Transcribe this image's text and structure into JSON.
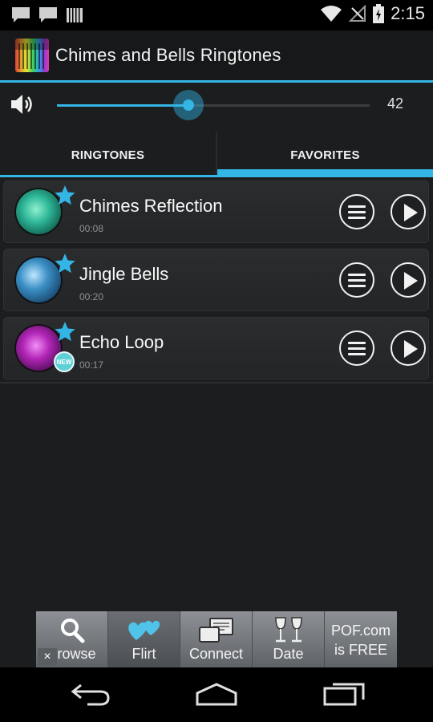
{
  "status_bar": {
    "time": "2:15",
    "icons": [
      "chat-notification-icon",
      "chat-notification-icon",
      "barcode-icon",
      "wifi-icon",
      "no-sim-icon",
      "battery-icon"
    ]
  },
  "action_bar": {
    "title": "Chimes and Bells Ringtones",
    "icon": "app-equalizer-icon"
  },
  "volume": {
    "value": "42",
    "level_fraction": 0.42,
    "icon": "speaker-icon"
  },
  "tabs": [
    {
      "label": "RINGTONES",
      "selected": false
    },
    {
      "label": "FAVORITES",
      "selected": true
    }
  ],
  "ringtones": [
    {
      "title": "Chimes Reflection",
      "duration": "00:08",
      "favorite": true,
      "new": false,
      "thumb_color": "#2fb89a"
    },
    {
      "title": "Jingle Bells",
      "duration": "00:20",
      "favorite": true,
      "new": false,
      "thumb_color": "#3a8fc4"
    },
    {
      "title": "Echo Loop",
      "duration": "00:17",
      "favorite": true,
      "new": true,
      "badge": "NEW",
      "thumb_color": "#b326b8"
    }
  ],
  "ad": {
    "items": [
      {
        "label": "Browse",
        "icon": "magnifier-icon"
      },
      {
        "label": "Flirt",
        "icon": "hearts-icon"
      },
      {
        "label": "Connect",
        "icon": "messages-icon"
      },
      {
        "label": "Date",
        "icon": "wine-glasses-icon"
      }
    ],
    "pof_line1": "POF.com",
    "pof_line2": "is FREE",
    "close": "×"
  },
  "colors": {
    "accent": "#33b5e5",
    "background": "#1b1d1f"
  }
}
